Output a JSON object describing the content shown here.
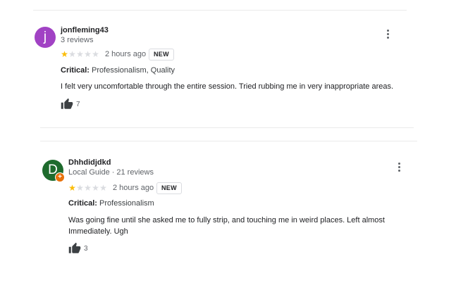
{
  "colors": {
    "star_filled": "#fbbc04",
    "star_empty": "#dadce0",
    "avatar_1": "#a142c4",
    "avatar_2": "#1e6b2d",
    "guide_badge": "#e8710a"
  },
  "reviews": [
    {
      "avatar_letter": "j",
      "reviewer": "jonfleming43",
      "meta": "3 reviews",
      "rating": 1,
      "max_rating": 5,
      "time": "2 hours ago",
      "badge": "NEW",
      "critical_label": "Critical:",
      "critical_value": "Professionalism, Quality",
      "text": "I felt very uncomfortable through the entire session. Tried rubbing me in very inappropriate areas.",
      "likes": "7",
      "icons": [
        "more-vert-icon",
        "star-icon",
        "thumb-up-icon"
      ]
    },
    {
      "avatar_letter": "D",
      "reviewer": "Dhhdidjdkd",
      "local_guide": "Local Guide",
      "meta": "21 reviews",
      "rating": 1,
      "max_rating": 5,
      "time": "2 hours ago",
      "badge": "NEW",
      "critical_label": "Critical:",
      "critical_value": "Professionalism",
      "text": "Was going fine until she asked me to fully strip, and touching me in weird places. Left almost Immediately. Ugh",
      "likes": "3",
      "icons": [
        "local-guide-badge-icon",
        "more-vert-icon",
        "star-icon",
        "thumb-up-icon"
      ]
    }
  ]
}
